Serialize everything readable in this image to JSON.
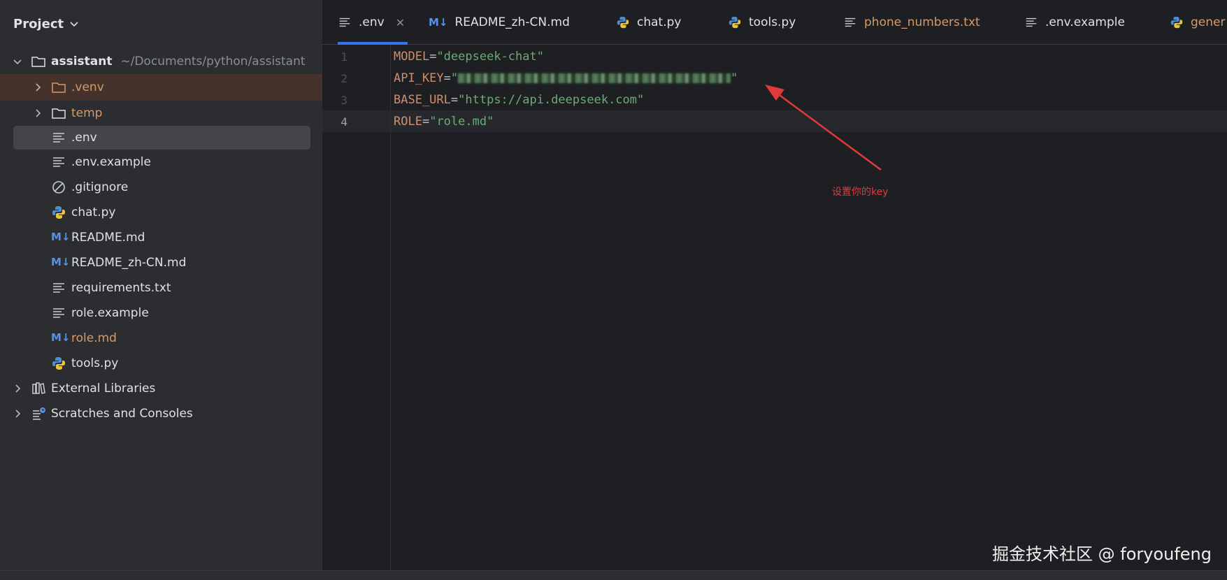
{
  "panel": {
    "title": "Project"
  },
  "tree": {
    "root": {
      "label": "assistant",
      "path": "~/Documents/python/assistant"
    },
    "items": [
      {
        "label": ".venv"
      },
      {
        "label": "temp"
      },
      {
        "label": ".env"
      },
      {
        "label": ".env.example"
      },
      {
        "label": ".gitignore"
      },
      {
        "label": "chat.py"
      },
      {
        "label": "README.md"
      },
      {
        "label": "README_zh-CN.md"
      },
      {
        "label": "requirements.txt"
      },
      {
        "label": "role.example"
      },
      {
        "label": "role.md"
      },
      {
        "label": "tools.py"
      }
    ],
    "external_libraries": "External Libraries",
    "scratches": "Scratches and Consoles"
  },
  "tabs": [
    {
      "label": ".env",
      "active": true
    },
    {
      "label": "README_zh-CN.md"
    },
    {
      "label": "chat.py"
    },
    {
      "label": "tools.py"
    },
    {
      "label": "phone_numbers.txt"
    },
    {
      "label": ".env.example"
    },
    {
      "label": "gener"
    }
  ],
  "editor": {
    "line_numbers": [
      "1",
      "2",
      "3",
      "4"
    ],
    "lines": [
      {
        "key": "MODEL",
        "eq": "=",
        "value": "\"deepseek-chat\""
      },
      {
        "key": "API_KEY",
        "eq": "=",
        "open": "\"",
        "close": "\""
      },
      {
        "key": "BASE_URL",
        "eq": "=",
        "value": "\"https://api.deepseek.com\""
      },
      {
        "key": "ROLE",
        "eq": "=",
        "value": "\"role.md\""
      }
    ]
  },
  "annotation": {
    "text": "设置你的key",
    "color": "#e23a3a"
  },
  "watermark": "掘金技术社区 @ foryoufeng",
  "colors": {
    "accent": "#3574f0",
    "keyword": "#cf8e6d",
    "string": "#6aab73",
    "sidebar_bg": "#2b2d30",
    "editor_bg": "#1e1f22"
  }
}
